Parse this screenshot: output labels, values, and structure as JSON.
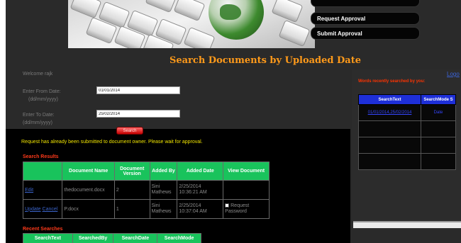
{
  "menu": {
    "items": [
      "Request Approval",
      "Submit Approval"
    ]
  },
  "page_title": "Search Documents by Uploaded Date",
  "welcome": "Welcome rajk",
  "form": {
    "from_label": "Enter From Date:",
    "from_hint": "(dd/mm/yyyy)",
    "from_value": "01/01/2014",
    "to_label": "Enter To Date:",
    "to_hint": "(dd/mm/yyyy)",
    "to_value": "25/02/2014",
    "search_label": "Search"
  },
  "notice": "Request has already been submitted to document owner. Please wait for approval.",
  "search_results": {
    "title": "Search Results",
    "headers": [
      "",
      "Document Name",
      "Document Version",
      "Added By",
      "Added Date",
      "View Document"
    ],
    "rows": [
      {
        "action1": "Edit",
        "action2": "",
        "name": "thedocument.docx",
        "version": "2",
        "added_by": "Sini Mathews",
        "added_date": "2/25/2014 10:36:21 AM",
        "view": ""
      },
      {
        "action1": "Update",
        "action2": "Cancel",
        "name": "P.docx",
        "version": "1",
        "added_by": "Sini Mathews",
        "added_date": "2/25/2014 10:37:04 AM",
        "view": "Request Password"
      }
    ]
  },
  "recent_searches": {
    "title": "Recent Searches",
    "headers": [
      "SearchText",
      "SearchedBy",
      "SearchDate",
      "SearchMode"
    ]
  },
  "side": {
    "logout": "Logo",
    "recent_words_title": "Words recently searched by you:",
    "headers": [
      "SearchText",
      "SearchMode S"
    ],
    "rows": [
      {
        "text": "01/01/2014,25/02/2014",
        "mode": "Date"
      },
      {
        "text": "",
        "mode": ""
      },
      {
        "text": "",
        "mode": ""
      },
      {
        "text": "",
        "mode": ""
      }
    ]
  },
  "colors": {
    "title": "#ff9a1a",
    "notice": "#f2e600",
    "section_title": "#ff3a1a",
    "table_header": "#19c35c",
    "side_header": "#1e2fd8"
  }
}
